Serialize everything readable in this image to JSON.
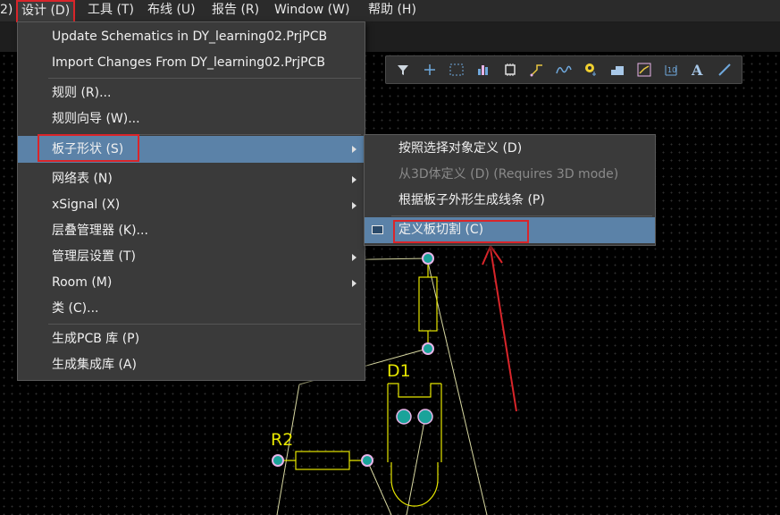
{
  "menubar": {
    "items": [
      {
        "label": "2)"
      },
      {
        "label": "设计 (D)"
      },
      {
        "label": "工具 (T)"
      },
      {
        "label": "布线 (U)"
      },
      {
        "label": "报告 (R)"
      },
      {
        "label": "Window (W)"
      },
      {
        "label": "帮助 (H)"
      }
    ],
    "active_index": 1
  },
  "design_menu": {
    "items": [
      {
        "label": "Update Schematics in DY_learning02.PrjPCB",
        "submenu": false
      },
      {
        "label": "Import Changes From DY_learning02.PrjPCB",
        "submenu": false
      },
      {
        "label": "规则 (R)...",
        "submenu": false
      },
      {
        "label": "规则向导 (W)...",
        "submenu": false
      },
      {
        "label": "板子形状 (S)",
        "submenu": true,
        "highlighted": true
      },
      {
        "label": "网络表 (N)",
        "submenu": true
      },
      {
        "label": "xSignal (X)",
        "submenu": true
      },
      {
        "label": "层叠管理器 (K)...",
        "submenu": false
      },
      {
        "label": "管理层设置 (T)",
        "submenu": true
      },
      {
        "label": "Room (M)",
        "submenu": true
      },
      {
        "label": "类 (C)...",
        "submenu": false
      },
      {
        "label": "生成PCB 库 (P)",
        "submenu": false
      },
      {
        "label": "生成集成库 (A)",
        "submenu": false
      }
    ]
  },
  "board_shape_submenu": {
    "items": [
      {
        "label": "按照选择对象定义 (D)",
        "enabled": true
      },
      {
        "label": "从3D体定义 (D) (Requires 3D mode)",
        "enabled": false
      },
      {
        "label": "根据板子外形生成线条 (P)",
        "enabled": true
      },
      {
        "label": "定义板切割 (C)",
        "enabled": true,
        "highlighted": true,
        "icon": "board-cutout-icon"
      }
    ]
  },
  "toolbar": {
    "icons": [
      "filter-icon",
      "cross-add-icon",
      "select-rect-icon",
      "bar-chart-icon",
      "chip-icon",
      "route-icon",
      "interactive-route-icon",
      "pad-icon",
      "board-shape-icon",
      "track-icon",
      "dimension-icon",
      "text-icon",
      "line-icon"
    ]
  },
  "pcb": {
    "designators": [
      "D1",
      "R2"
    ]
  },
  "colors": {
    "menu_bg": "#3a3a3a",
    "highlight": "#5b82a8",
    "annotation_red": "#d9252a",
    "silkscreen": "#e6e600",
    "pad": "#1aa39a",
    "ratsnest": "#d6d6a0"
  }
}
